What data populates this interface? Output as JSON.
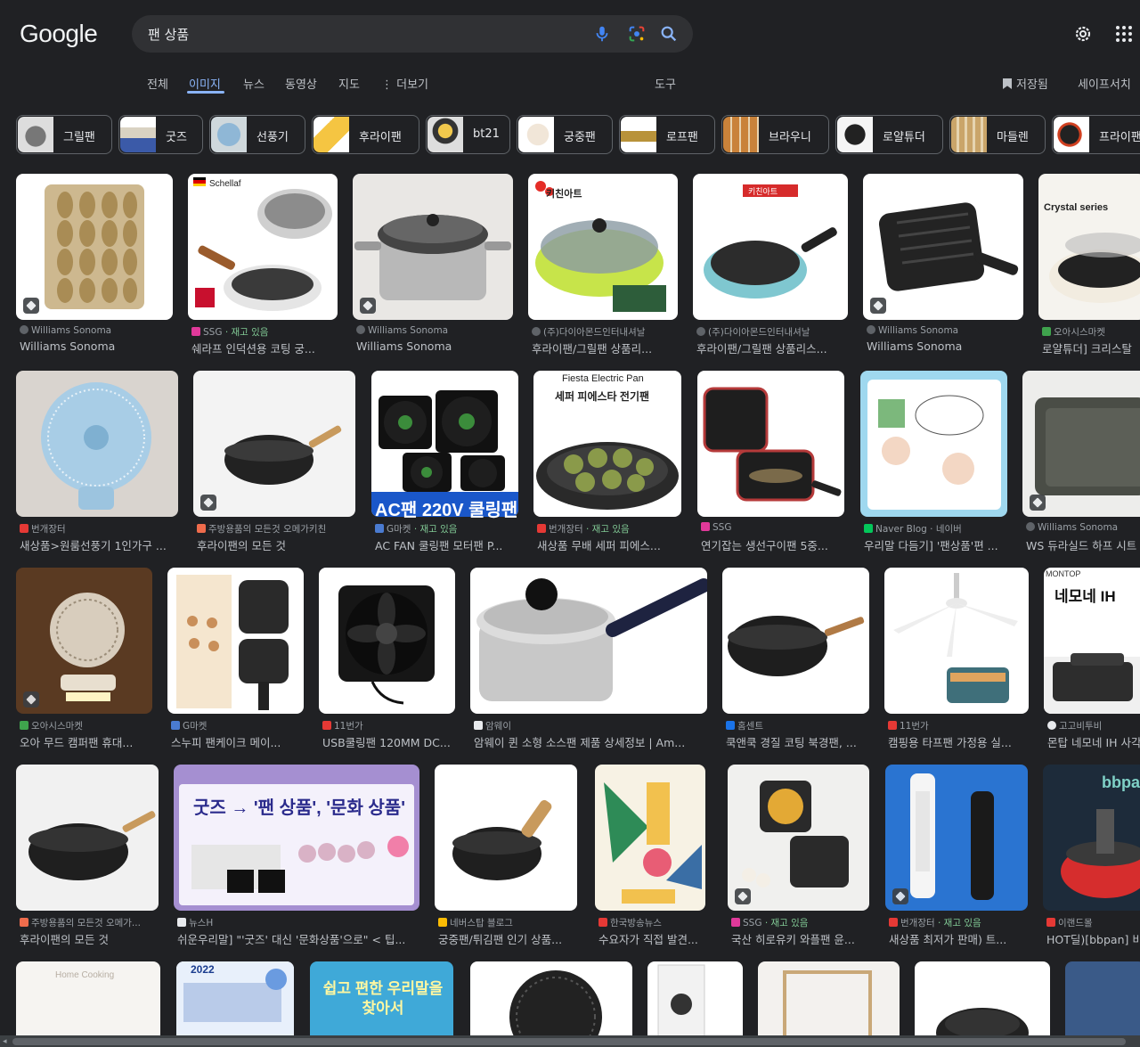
{
  "header": {
    "logo": "Google",
    "search_value": "팬 상품"
  },
  "nav": {
    "tabs": [
      "전체",
      "이미지",
      "뉴스",
      "동영상",
      "지도",
      "더보기"
    ],
    "active": "이미지",
    "tools": "도구",
    "saved": "저장됨",
    "safesearch": "세이프서치"
  },
  "chips": [
    "그릴팬",
    "굿즈",
    "선풍기",
    "후라이팬",
    "bt21",
    "궁중팬",
    "로프팬",
    "브라우니",
    "로얄튜더",
    "마들렌",
    "프라이팬"
  ],
  "results": [
    {
      "source": "Williams Sonoma",
      "title": "Williams Sonoma"
    },
    {
      "source": "SSG",
      "stock": "· 재고 있음",
      "title": "쉐라프 인덕션용 코팅 궁..."
    },
    {
      "source": "Williams Sonoma",
      "title": "Williams Sonoma"
    },
    {
      "source": "(주)다이아몬드인터내셔날",
      "title": "후라이팬/그릴팬 상품리..."
    },
    {
      "source": "(주)다이아몬드인터내셔날",
      "title": "후라이팬/그릴팬 상품리스..."
    },
    {
      "source": "Williams Sonoma",
      "title": "Williams Sonoma"
    },
    {
      "source": "오아시스마켓",
      "title": "로얄튜더] 크리스탈"
    },
    {
      "source": "번개장터",
      "title": "새상품>원룸선풍기 1인가구 ..."
    },
    {
      "source": "주방용품의 모든것 오메가키친",
      "title": "후라이팬의 모든 것"
    },
    {
      "source": "G마켓",
      "stock": "· 재고 있음",
      "title": "AC FAN 쿨링팬 모터팬 P..."
    },
    {
      "source": "번개장터",
      "stock": "· 재고 있음",
      "title": "새상품 무배 세퍼 피에스..."
    },
    {
      "source": "SSG",
      "title": "연기잡는 생선구이팬 5중..."
    },
    {
      "source": "Naver Blog · 네이버",
      "title": "우리말 다듬기] '팬상품'편 ..."
    },
    {
      "source": "Williams Sonoma",
      "title": "WS 듀라실드 하프 시트"
    },
    {
      "source": "오아시스마켓",
      "title": "오아 무드 캠퍼팬 휴대..."
    },
    {
      "source": "G마켓",
      "title": "스누피 팬케이크 메이..."
    },
    {
      "source": "11번가",
      "title": "USB쿨링팬 120MM DC..."
    },
    {
      "source": "암웨이",
      "title": "암웨이 퀸 소형 소스팬 제품 상세정보 | Am..."
    },
    {
      "source": "홈센트",
      "title": "쿡앤쿡 경질 코팅 북경팬, ..."
    },
    {
      "source": "11번가",
      "title": "캠핑용 타프팬 가정용 실..."
    },
    {
      "source": "고고비투비",
      "title": "몬탑 네모네 IH 사각"
    },
    {
      "source": "주방용품의 모든것 오메가...",
      "title": "후라이팬의 모든 것"
    },
    {
      "source": "뉴스H",
      "title": "쉬운우리말] \"'굿즈' 대신 '문화상품'으로\" < 팁..."
    },
    {
      "source": "네버스탑 블로그",
      "title": "궁중팬/튀김팬 인기 상품..."
    },
    {
      "source": "한국방송뉴스",
      "title": "수요자가 직접 발견..."
    },
    {
      "source": "SSG",
      "stock": "· 재고 있음",
      "title": "국산 히로유키 와플팬 윤..."
    },
    {
      "source": "번개장터",
      "stock": "· 재고 있음",
      "title": "새상품 최저가 판매) 트..."
    },
    {
      "source": "이랜드몰",
      "title": "HOT딜)[bbpan] 비"
    }
  ],
  "image_text": {
    "schellaf": "Schellaf",
    "crystal": "Crystal series",
    "kitchen_art": "키친아트",
    "fan220": "AC팬 220V 쿨링팬",
    "fiesta_en": "Fiesta Electric Pan",
    "fiesta_kr": "세퍼 피에스타 전기팬",
    "nemone": "네모네 IH",
    "montop": "MONTOP",
    "goods_banner": "굿즈 → '팬 상품', '문화 상품'",
    "bbpan": "bbpan",
    "easy_word": "쉽고 편한 우리말을 찾아서",
    "year2022": "2022",
    "home_cooking": "Home Cooking"
  },
  "colors": {
    "background": "#202124",
    "accent": "#8ab4f8",
    "stock": "#81c995"
  }
}
